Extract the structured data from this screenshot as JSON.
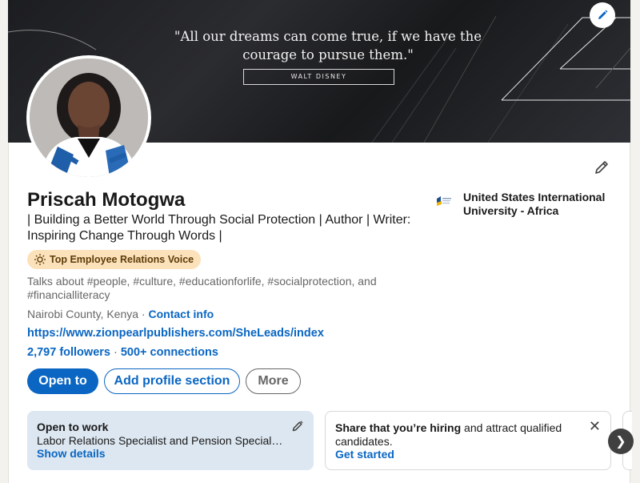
{
  "banner": {
    "quote": "\"All our dreams can come true, if we have the courage to pursue them.\"",
    "quote_author": "WALT DISNEY",
    "edit_icon": "pencil-icon"
  },
  "profile": {
    "name": "Priscah Motogwa",
    "headline": "| Building a Better World Through Social Protection | Author | Writer: Inspiring Change Through Words |",
    "badge": "Top Employee Relations Voice",
    "talks_about": "Talks about #people, #culture, #educationforlife, #socialprotection, and #financialliteracy",
    "location": "Nairobi County, Kenya",
    "location_separator": " · ",
    "contact_info": "Contact info",
    "website": "https://www.zionpearlpublishers.com/SheLeads/index",
    "followers": "2,797 followers",
    "stats_separator": " · ",
    "connections": "500+ connections",
    "organization": "United States International University - Africa"
  },
  "actions": {
    "open_to": "Open to",
    "add_section": "Add profile section",
    "more": "More"
  },
  "open_to_work": {
    "title": "Open to work",
    "roles": "Labor Relations Specialist and Pension Specialist roles",
    "action": "Show details"
  },
  "hiring": {
    "title": "Share that you’re hiring",
    "text": " and attract qualified candidates.",
    "action": "Get started",
    "close": "✕"
  },
  "carousel": {
    "next": "❯"
  },
  "colors": {
    "primary": "#0a66c2",
    "badge_bg": "#fce2ba",
    "work_panel_bg": "#dde7f1"
  }
}
